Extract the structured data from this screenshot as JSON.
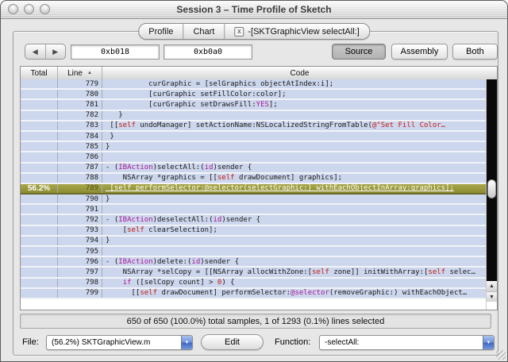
{
  "window": {
    "title": "Session 3 – Time Profile of Sketch"
  },
  "tabs": [
    {
      "label": "Profile"
    },
    {
      "label": "Chart"
    },
    {
      "label": "-[SKTGraphicView selectAll:]",
      "close_glyph": "x"
    }
  ],
  "toolbar": {
    "back_glyph": "◀",
    "forward_glyph": "▶",
    "address1": "0xb018",
    "address2": "0xb0a0",
    "view_buttons": [
      {
        "label": "Source",
        "selected": true
      },
      {
        "label": "Assembly",
        "selected": false
      },
      {
        "label": "Both",
        "selected": false
      }
    ]
  },
  "table": {
    "columns": [
      "Total",
      "Line",
      "Code"
    ],
    "sort_arrow": "▲",
    "rows": [
      {
        "line": "779",
        "total": "",
        "hl": false,
        "seg": [
          {
            "c": "p",
            "t": "          curGraphic = [selGraphics objectAtIndex:i];"
          }
        ]
      },
      {
        "line": "780",
        "total": "",
        "hl": false,
        "seg": [
          {
            "c": "p",
            "t": "          [curGraphic setFillColor:color];"
          }
        ]
      },
      {
        "line": "781",
        "total": "",
        "hl": false,
        "seg": [
          {
            "c": "p",
            "t": "          [curGraphic setDrawsFill:"
          },
          {
            "c": "k",
            "t": "YES"
          },
          {
            "c": "p",
            "t": "];"
          }
        ]
      },
      {
        "line": "782",
        "total": "",
        "hl": false,
        "seg": [
          {
            "c": "p",
            "t": "   }"
          }
        ]
      },
      {
        "line": "783",
        "total": "",
        "hl": false,
        "seg": [
          {
            "c": "p",
            "t": " [["
          },
          {
            "c": "r",
            "t": "self"
          },
          {
            "c": "p",
            "t": " undoManager] setActionName:NSLocalizedStringFromTable("
          },
          {
            "c": "r",
            "t": "@\"Set Fill Color…"
          }
        ]
      },
      {
        "line": "784",
        "total": "",
        "hl": false,
        "seg": [
          {
            "c": "p",
            "t": " }"
          }
        ]
      },
      {
        "line": "785",
        "total": "",
        "hl": false,
        "seg": [
          {
            "c": "p",
            "t": "}"
          }
        ]
      },
      {
        "line": "786",
        "total": "",
        "hl": false,
        "seg": []
      },
      {
        "line": "787",
        "total": "",
        "hl": false,
        "seg": [
          {
            "c": "p",
            "t": "- ("
          },
          {
            "c": "k",
            "t": "IBAction"
          },
          {
            "c": "p",
            "t": ")selectAll:("
          },
          {
            "c": "k",
            "t": "id"
          },
          {
            "c": "p",
            "t": ")sender {"
          }
        ]
      },
      {
        "line": "788",
        "total": "",
        "hl": false,
        "seg": [
          {
            "c": "p",
            "t": "    NSArray *graphics = [["
          },
          {
            "c": "r",
            "t": "self"
          },
          {
            "c": "p",
            "t": " drawDocument] graphics];"
          }
        ]
      },
      {
        "line": "789",
        "total": "56.2%",
        "hl": true,
        "seg": [
          {
            "c": "w",
            "t": " [self performSelector:@selector(selectGraphic:) withEachObjectInArray:graphics];"
          }
        ]
      },
      {
        "line": "790",
        "total": "",
        "hl": false,
        "seg": [
          {
            "c": "p",
            "t": "}"
          }
        ]
      },
      {
        "line": "791",
        "total": "",
        "hl": false,
        "seg": []
      },
      {
        "line": "792",
        "total": "",
        "hl": false,
        "seg": [
          {
            "c": "p",
            "t": "- ("
          },
          {
            "c": "k",
            "t": "IBAction"
          },
          {
            "c": "p",
            "t": ")deselectAll:("
          },
          {
            "c": "k",
            "t": "id"
          },
          {
            "c": "p",
            "t": ")sender {"
          }
        ]
      },
      {
        "line": "793",
        "total": "",
        "hl": false,
        "seg": [
          {
            "c": "p",
            "t": "    ["
          },
          {
            "c": "r",
            "t": "self"
          },
          {
            "c": "p",
            "t": " clearSelection];"
          }
        ]
      },
      {
        "line": "794",
        "total": "",
        "hl": false,
        "seg": [
          {
            "c": "p",
            "t": "}"
          }
        ]
      },
      {
        "line": "795",
        "total": "",
        "hl": false,
        "seg": []
      },
      {
        "line": "796",
        "total": "",
        "hl": false,
        "seg": [
          {
            "c": "p",
            "t": "- ("
          },
          {
            "c": "k",
            "t": "IBAction"
          },
          {
            "c": "p",
            "t": ")delete:("
          },
          {
            "c": "k",
            "t": "id"
          },
          {
            "c": "p",
            "t": ")sender {"
          }
        ]
      },
      {
        "line": "797",
        "total": "",
        "hl": false,
        "seg": [
          {
            "c": "p",
            "t": "    NSArray *selCopy = [[NSArray allocWithZone:["
          },
          {
            "c": "r",
            "t": "self"
          },
          {
            "c": "p",
            "t": " zone]] initWithArray:["
          },
          {
            "c": "r",
            "t": "self"
          },
          {
            "c": "p",
            "t": " selec…"
          }
        ]
      },
      {
        "line": "798",
        "total": "",
        "hl": false,
        "seg": [
          {
            "c": "p",
            "t": "    "
          },
          {
            "c": "k",
            "t": "if"
          },
          {
            "c": "p",
            "t": " ([selCopy count] > "
          },
          {
            "c": "r",
            "t": "0"
          },
          {
            "c": "p",
            "t": ") {"
          }
        ]
      },
      {
        "line": "799",
        "total": "",
        "hl": false,
        "seg": [
          {
            "c": "p",
            "t": "      [["
          },
          {
            "c": "r",
            "t": "self"
          },
          {
            "c": "p",
            "t": " drawDocument] performSelector:"
          },
          {
            "c": "k",
            "t": "@selector"
          },
          {
            "c": "p",
            "t": "(removeGraphic:) withEachObject…"
          }
        ]
      }
    ]
  },
  "status": {
    "text": "650 of 650 (100.0%) total samples, 1 of 1293 (0.1%) lines selected"
  },
  "footer": {
    "file_label": "File:",
    "file_value": "(56.2%) SKTGraphicView.m",
    "edit_label": "Edit",
    "function_label": "Function:",
    "function_value": "-selectAll:"
  },
  "colors": {
    "row_blue": "#ccd6ec",
    "highlight_olive": "#98973e",
    "keyword_purple": "#a81a96",
    "literal_red": "#c41a16",
    "scroll_track_black": "#0a0a0a"
  }
}
